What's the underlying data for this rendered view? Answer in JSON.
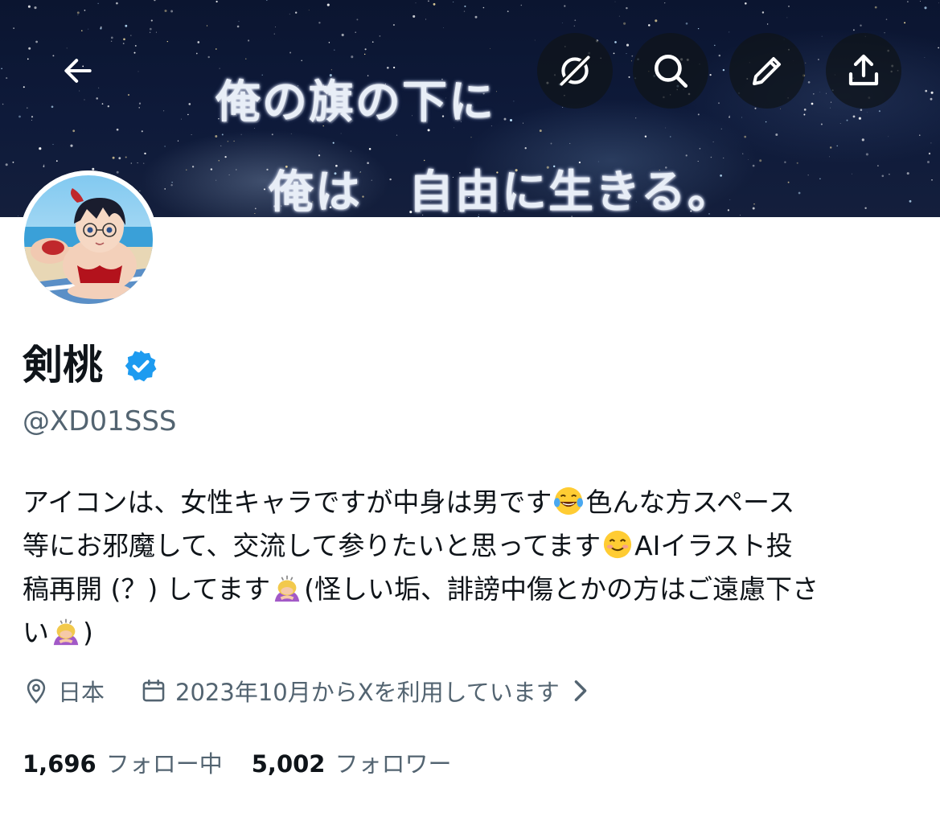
{
  "banner": {
    "line1": "俺の旗の下に",
    "line2": "俺は　自由に生きる。"
  },
  "header": {
    "icons": [
      "back-arrow-icon",
      "grok-icon",
      "search-icon",
      "edit-pencil-icon",
      "share-icon"
    ]
  },
  "profile": {
    "name": "剣桃",
    "verified": true,
    "handle": "@XD01SSS",
    "bio": {
      "line1_a": "アイコンは、女性キャラですが中身は男です",
      "line1_b": "色んな方スペース",
      "line2_a": "等にお邪魔して、交流して参りたいと思ってます",
      "line2_b": "AIイラスト投",
      "line3_a": "稿再開 (？) してます",
      "line3_b": "(怪しい垢、誹謗中傷とかの方はご遠慮下さ",
      "line4_a": "い",
      "line4_b": ")"
    },
    "location": "日本",
    "joined": "2023年10月からXを利用しています"
  },
  "stats": {
    "following_count": "1,696",
    "following_label": "フォロー中",
    "followers_count": "5,002",
    "followers_label": "フォロワー"
  },
  "colors": {
    "text": "#0f1419",
    "secondary": "#536471",
    "verified": "#1d9bf0",
    "banner": "#0e1a3a"
  }
}
